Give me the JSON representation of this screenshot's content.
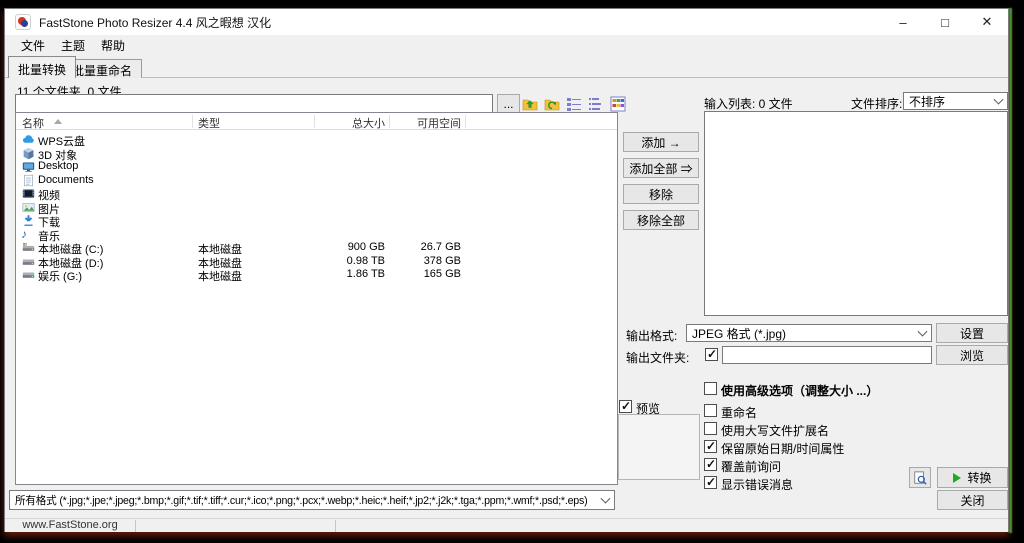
{
  "window": {
    "title": "FastStone Photo Resizer 4.4  风之暇想 汉化",
    "minimize": "–",
    "maximize": "□",
    "close": "✕"
  },
  "menu": {
    "items": [
      "文件",
      "主题",
      "帮助"
    ]
  },
  "tabs": {
    "batch_convert": "批量转换",
    "batch_rename": "批量重命名"
  },
  "browser": {
    "count_label": "11 个文件夹, 0 文件",
    "path_value": "",
    "ellipsis_button": "...",
    "columns": {
      "name": "名称",
      "type": "类型",
      "total": "总大小",
      "free": "可用空间"
    },
    "rows": [
      {
        "name": "WPS云盘",
        "type": "",
        "total": "",
        "free": ""
      },
      {
        "name": "3D 对象",
        "type": "",
        "total": "",
        "free": ""
      },
      {
        "name": "Desktop",
        "type": "",
        "total": "",
        "free": ""
      },
      {
        "name": "Documents",
        "type": "",
        "total": "",
        "free": ""
      },
      {
        "name": "视频",
        "type": "",
        "total": "",
        "free": ""
      },
      {
        "name": "图片",
        "type": "",
        "total": "",
        "free": ""
      },
      {
        "name": "下载",
        "type": "",
        "total": "",
        "free": ""
      },
      {
        "name": "音乐",
        "type": "",
        "total": "",
        "free": ""
      },
      {
        "name": "本地磁盘 (C:)",
        "type": "本地磁盘",
        "total": "900 GB",
        "free": "26.7 GB"
      },
      {
        "name": "本地磁盘 (D:)",
        "type": "本地磁盘",
        "total": "0.98 TB",
        "free": "378 GB"
      },
      {
        "name": "娱乐 (G:)",
        "type": "本地磁盘",
        "total": "1.86 TB",
        "free": "165 GB"
      }
    ],
    "filter_value": "所有格式 (*.jpg;*.jpe;*.jpeg;*.bmp;*.gif;*.tif;*.tiff;*.cur;*.ico;*.png;*.pcx;*.webp;*.heic;*.heif;*.jp2;*.j2k;*.tga;*.ppm;*.wmf;*.psd;*.eps)"
  },
  "input_list": {
    "label": "输入列表: 0 文件",
    "sort_label": "文件排序:",
    "sort_value": "不排序"
  },
  "actions": {
    "add": "添加 →",
    "add_all": "添加全部 ⇒",
    "remove": "移除",
    "remove_all": "移除全部"
  },
  "output": {
    "format_label": "输出格式:",
    "format_value": "JPEG 格式 (*.jpg)",
    "settings": "设置",
    "folder_label": "输出文件夹:",
    "folder_checked": true,
    "folder_value": "",
    "browse": "浏览"
  },
  "options": {
    "advanced": {
      "label": "使用高级选项（调整大小 ...）",
      "checked": false
    },
    "preview": {
      "label": "预览",
      "checked": true
    },
    "rename": {
      "label": "重命名",
      "checked": false
    },
    "uppercase": {
      "label": "使用大写文件扩展名",
      "checked": false
    },
    "keep_date": {
      "label": "保留原始日期/时间属性",
      "checked": true
    },
    "ask_overwrite": {
      "label": "覆盖前询问",
      "checked": true
    },
    "show_errors": {
      "label": "显示错误消息",
      "checked": true
    }
  },
  "footer": {
    "convert": "转换",
    "close": "关闭"
  },
  "statusbar": {
    "text": "www.FastStone.org"
  }
}
